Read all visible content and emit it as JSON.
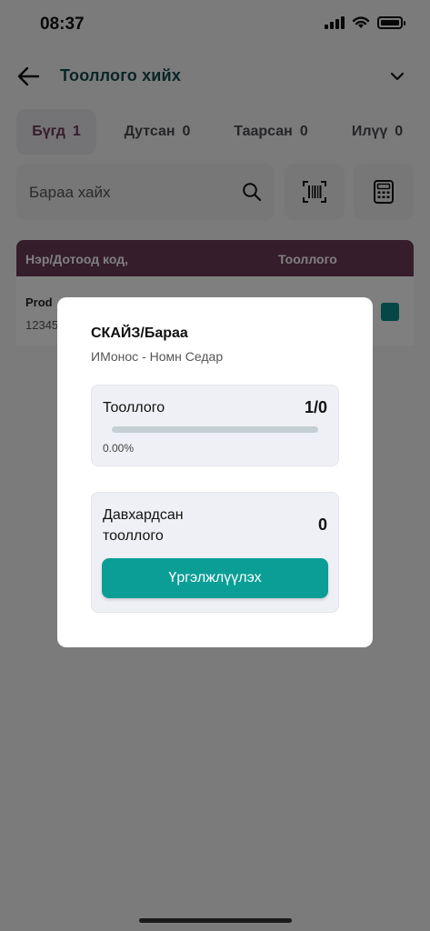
{
  "status_bar": {
    "time": "08:37"
  },
  "header": {
    "title": "Тооллого хийх"
  },
  "tabs": [
    {
      "label": "Бүгд",
      "count": "1"
    },
    {
      "label": "Дутсан",
      "count": "0"
    },
    {
      "label": "Таарсан",
      "count": "0"
    },
    {
      "label": "Илүү",
      "count": "0"
    }
  ],
  "search": {
    "placeholder": "Бараа хайх"
  },
  "table": {
    "headers": {
      "name": "Нэр/Дотоод код,",
      "count": "Тооллого"
    },
    "rows": [
      {
        "name": "Prod",
        "code": "12345"
      }
    ]
  },
  "dialog": {
    "title": "СКАЙЗ/Бараа",
    "subtitle": "ИМонос - Номн Седар",
    "count_card": {
      "label": "Тооллого",
      "value": "1/0",
      "progress": 0.0,
      "percent_text": "0.00%"
    },
    "duplicate_card": {
      "label": "Давхардсан тооллого",
      "value": "0"
    },
    "continue_label": "Үргэлжлүүлэх"
  },
  "colors": {
    "accent": "#0b9e96",
    "brand": "#6b3a56",
    "title": "#144a4a"
  },
  "icons": [
    "back-arrow-icon",
    "chevron-down-icon",
    "search-icon",
    "barcode-icon",
    "calculator-icon",
    "wifi-icon",
    "signal-icon",
    "battery-icon"
  ]
}
